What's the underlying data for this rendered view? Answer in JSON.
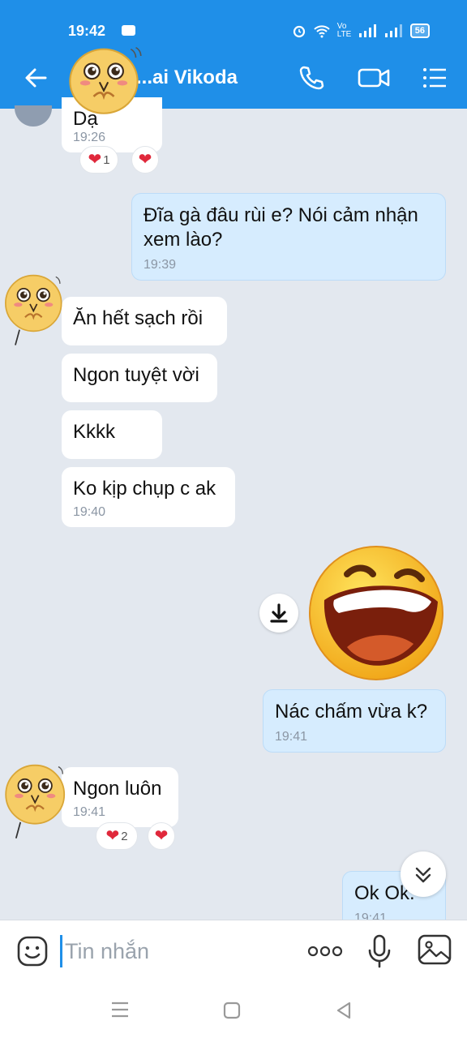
{
  "status_bar": {
    "time": "19:42",
    "app_badge": "Zalo",
    "network": "Vo LTE",
    "battery": "56"
  },
  "header": {
    "back_label": "Back",
    "contact_name": "...ai Vikoda"
  },
  "messages": [
    {
      "text": "Dạ",
      "time": "19:26",
      "reaction_count": "1"
    },
    {
      "text": "Đĩa gà đâu rùi e? Nói cảm nhận xem lào?",
      "time": "19:39"
    },
    {
      "text": "Ăn hết sạch rồi"
    },
    {
      "text": "Ngon tuyệt vời"
    },
    {
      "text": "Kkkk"
    },
    {
      "text": "Ko kịp chụp c ak",
      "time": "19:40"
    },
    {
      "text": "Nác chấm vừa k?",
      "time": "19:41"
    },
    {
      "text": "Ngon luôn",
      "time": "19:41",
      "reaction_count": "2"
    },
    {
      "text": "Ok Ok.",
      "time": "19:41"
    }
  ],
  "composer": {
    "placeholder": "Tin nhắn"
  },
  "colors": {
    "header_blue": "#1f8fe8",
    "my_bubble": "#d6ecfe",
    "their_bubble": "#ffffff",
    "chat_bg": "#e3e8ef",
    "heart": "#e0283b"
  },
  "icons": [
    "back-arrow-icon",
    "phone-icon",
    "video-call-icon",
    "menu-list-icon",
    "download-icon",
    "laughing-emoji-sticker",
    "chevron-double-down-icon",
    "emoji-icon",
    "more-dots-icon",
    "microphone-icon",
    "image-icon",
    "nav-menu-icon",
    "nav-home-icon",
    "nav-back-icon"
  ]
}
